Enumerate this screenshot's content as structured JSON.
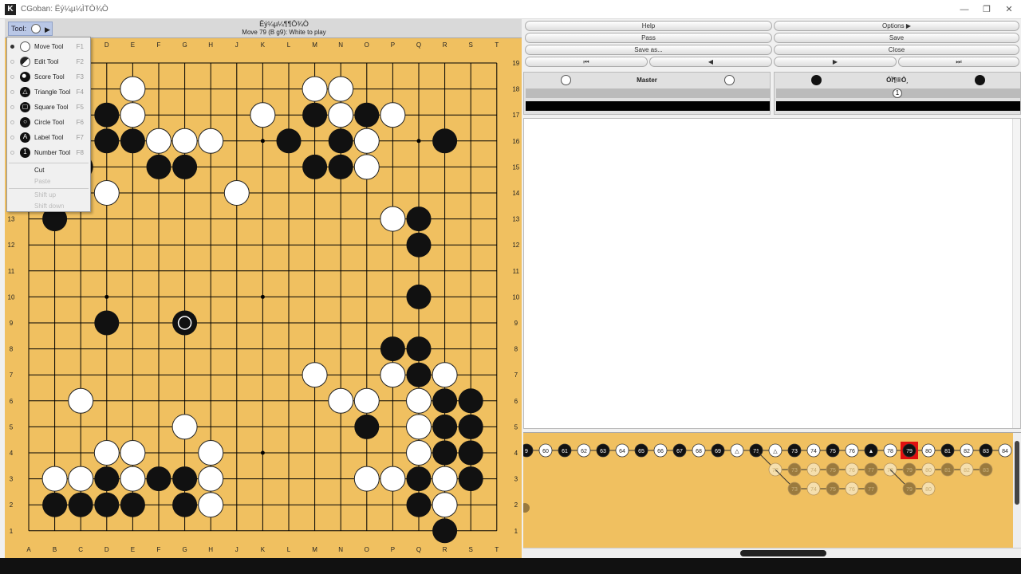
{
  "window": {
    "app_icon": "K",
    "title": "CGoban: Ëý¼µ¼ÌTÒ¾Ò",
    "minimize": "—",
    "maximize": "❐",
    "close": "✕"
  },
  "board_header": {
    "tool_label": "Tool:",
    "title": "Ëý¼µ¼¶¶Ö¾Ò",
    "status": "Move 79 (B g9): White to play"
  },
  "tool_menu": {
    "items": [
      {
        "label": "Move Tool",
        "key": "F1",
        "icon": "white-stone-icon",
        "selected": true
      },
      {
        "label": "Edit Tool",
        "key": "F2",
        "icon": "edit-stones-icon",
        "selected": false
      },
      {
        "label": "Score Tool",
        "key": "F3",
        "icon": "score-icon",
        "selected": false
      },
      {
        "label": "Triangle Tool",
        "key": "F4",
        "icon": "triangle-icon",
        "selected": false
      },
      {
        "label": "Square Tool",
        "key": "F5",
        "icon": "square-icon",
        "selected": false
      },
      {
        "label": "Circle Tool",
        "key": "F6",
        "icon": "circle-icon",
        "selected": false
      },
      {
        "label": "Label Tool",
        "key": "F7",
        "icon": "label-a-icon",
        "selected": false
      },
      {
        "label": "Number Tool",
        "key": "F8",
        "icon": "number-1-icon",
        "selected": false
      }
    ],
    "cut": "Cut",
    "paste": "Paste",
    "shift_up": "Shift up",
    "shift_down": "Shift down"
  },
  "board": {
    "columns": [
      "A",
      "B",
      "C",
      "D",
      "E",
      "F",
      "G",
      "H",
      "J",
      "K",
      "L",
      "M",
      "N",
      "O",
      "P",
      "Q",
      "R",
      "S",
      "T"
    ],
    "rows": [
      "19",
      "18",
      "17",
      "16",
      "15",
      "14",
      "13",
      "12",
      "11",
      "10",
      "9",
      "8",
      "7",
      "6",
      "5",
      "4",
      "3",
      "2",
      "1"
    ],
    "black": [
      "D17",
      "D16",
      "E16",
      "F15",
      "G15",
      "M17",
      "M15",
      "N16",
      "N15",
      "O17",
      "L16",
      "R16",
      "C15",
      "B13",
      "Q13",
      "Q12",
      "Q10",
      "D9",
      "P8",
      "Q8",
      "Q7",
      "R6",
      "S6",
      "O5",
      "R5",
      "S5",
      "R4",
      "S4",
      "D3",
      "F3",
      "G3",
      "Q3",
      "S3",
      "B2",
      "C2",
      "D2",
      "E2",
      "G2",
      "Q2",
      "R1"
    ],
    "white": [
      "E18",
      "E17",
      "F16",
      "G16",
      "H16",
      "M18",
      "N18",
      "N17",
      "O16",
      "O15",
      "P17",
      "K17",
      "D14",
      "J14",
      "P13",
      "G5",
      "M7",
      "P7",
      "R7",
      "C6",
      "N6",
      "O6",
      "Q6",
      "Q5",
      "Q4",
      "D4",
      "E4",
      "H4",
      "B3",
      "C3",
      "E3",
      "H3",
      "O3",
      "P3",
      "R3",
      "H2",
      "R2"
    ],
    "last_move": "G9",
    "hoshi": [
      "D16",
      "K16",
      "Q16",
      "D10",
      "K10",
      "Q10",
      "D4",
      "K4",
      "Q4"
    ]
  },
  "controls": {
    "help": "Help",
    "options": "Options",
    "pass": "Pass",
    "save": "Save",
    "save_as": "Save as...",
    "close": "Close",
    "first": "⏮",
    "prev": "◀",
    "next": "▶",
    "last": "⏭"
  },
  "players": {
    "white_name": "Master",
    "black_name": "ÓÏ¶®Ò¸",
    "black_captures": "1"
  },
  "tree": {
    "main": [
      {
        "n": "9",
        "c": "b"
      },
      {
        "n": "60",
        "c": "w"
      },
      {
        "n": "61",
        "c": "b"
      },
      {
        "n": "62",
        "c": "w"
      },
      {
        "n": "63",
        "c": "b"
      },
      {
        "n": "64",
        "c": "w"
      },
      {
        "n": "65",
        "c": "b"
      },
      {
        "n": "66",
        "c": "w"
      },
      {
        "n": "67",
        "c": "b"
      },
      {
        "n": "68",
        "c": "w"
      },
      {
        "n": "69",
        "c": "b"
      },
      {
        "n": "△",
        "c": "w"
      },
      {
        "n": "71",
        "c": "b"
      },
      {
        "n": "△",
        "c": "w"
      },
      {
        "n": "73",
        "c": "b"
      },
      {
        "n": "74",
        "c": "w"
      },
      {
        "n": "75",
        "c": "b"
      },
      {
        "n": "76",
        "c": "w"
      },
      {
        "n": "▲",
        "c": "b"
      },
      {
        "n": "78",
        "c": "w"
      },
      {
        "n": "79",
        "c": "b"
      },
      {
        "n": "80",
        "c": "w"
      },
      {
        "n": "81",
        "c": "b"
      },
      {
        "n": "82",
        "c": "w"
      },
      {
        "n": "83",
        "c": "b"
      },
      {
        "n": "84",
        "c": "w"
      }
    ],
    "var1": [
      {
        "n": "72",
        "c": "w"
      },
      {
        "n": "73",
        "c": "b"
      },
      {
        "n": "74",
        "c": "w"
      },
      {
        "n": "75",
        "c": "b"
      },
      {
        "n": "76",
        "c": "w"
      },
      {
        "n": "77",
        "c": "b"
      },
      {
        "n": "78",
        "c": "w"
      },
      {
        "n": "79",
        "c": "b"
      },
      {
        "n": "80",
        "c": "w"
      },
      {
        "n": "81",
        "c": "b"
      },
      {
        "n": "82",
        "c": "w"
      },
      {
        "n": "83",
        "c": "b"
      }
    ],
    "var2": [
      {
        "n": "73",
        "c": "b"
      },
      {
        "n": "74",
        "c": "w"
      },
      {
        "n": "75",
        "c": "b"
      },
      {
        "n": "76",
        "c": "w"
      },
      {
        "n": "77",
        "c": "b"
      }
    ],
    "var3": [
      {
        "n": "79",
        "c": "b"
      },
      {
        "n": "80",
        "c": "w"
      }
    ],
    "current": "79"
  }
}
